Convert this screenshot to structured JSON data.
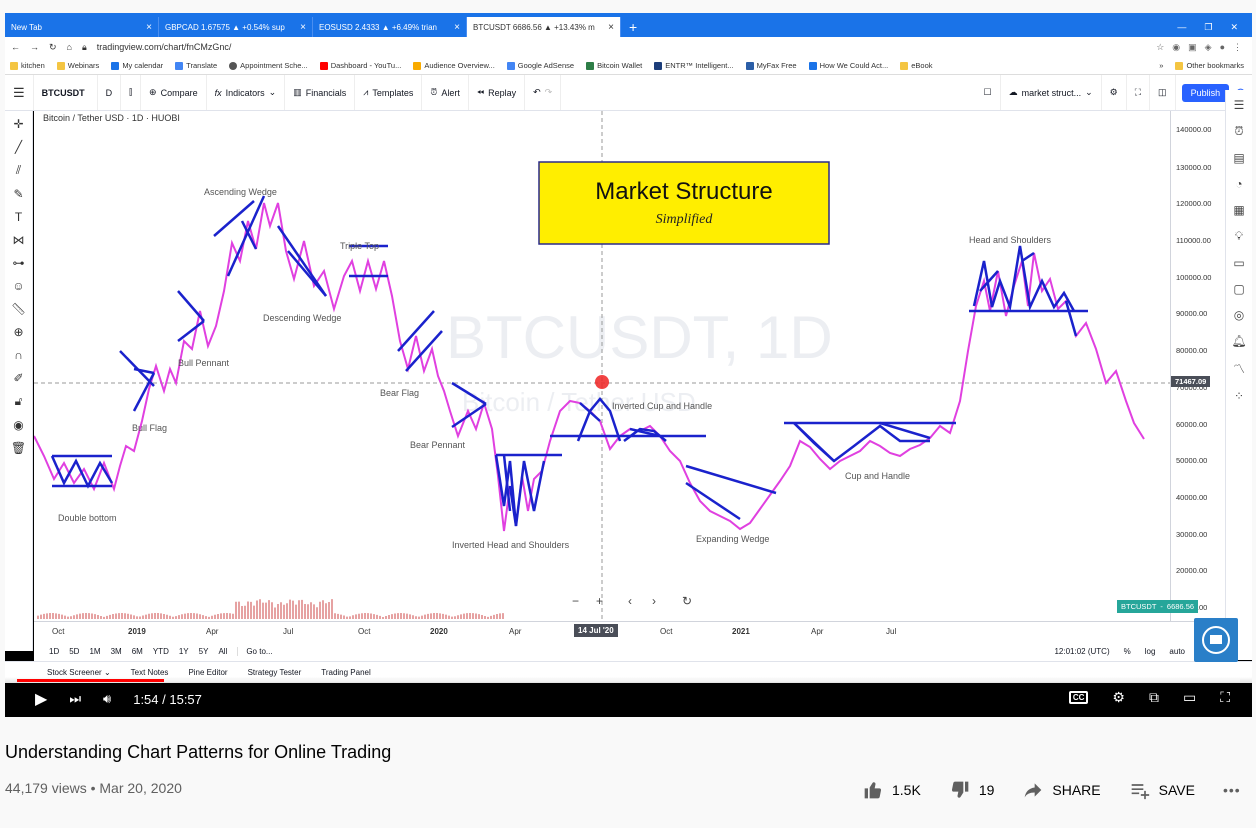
{
  "browser": {
    "tabs": [
      {
        "label": "New Tab",
        "active": false
      },
      {
        "label": "GBPCAD 1.67575 ▲ +0.54% sup",
        "active": false
      },
      {
        "label": "EOSUSD 2.4333 ▲ +6.49% trian",
        "active": false
      },
      {
        "label": "BTCUSDT 6686.56 ▲ +13.43% m",
        "active": true
      }
    ],
    "new_tab": "+",
    "url": "tradingview.com/chart/fnCMzGnc/",
    "bookmarks": [
      "kitchen",
      "Webinars",
      "My calendar",
      "Translate",
      "Appointment Sche...",
      "Dashboard - YouTu...",
      "Audience Overview...",
      "Google AdSense",
      "Bitcoin Wallet",
      "ENTR™ Intelligent...",
      "MyFax Free",
      "How We Could Act...",
      "eBook"
    ],
    "other_bookmarks": "Other bookmarks"
  },
  "tv": {
    "symbol": "BTCUSDT",
    "interval": "D",
    "compare": "Compare",
    "indicators": "Indicators",
    "financials": "Financials",
    "templates": "Templates",
    "alert": "Alert",
    "replay": "Replay",
    "layout_name": "market struct...",
    "publish": "Publish",
    "legend": "Bitcoin / Tether USD · 1D · HUOBI",
    "watermark_title": "BTCUSDT, 1D",
    "watermark_sub": "Bitcoin / Tether USD",
    "banner_title": "Market Structure",
    "banner_sub": "Simplified",
    "crosshair_price": "71467.09",
    "last_price_label": "BTCUSDT",
    "last_price": "6686.56",
    "crosshair_date": "14 Jul '20",
    "time_labels": [
      "Oct",
      "2019",
      "Apr",
      "Jul",
      "Oct",
      "2020",
      "Apr",
      "Jul",
      "Oct",
      "2021",
      "Apr",
      "Jul"
    ],
    "price_labels": [
      "140000.00",
      "130000.00",
      "120000.00",
      "110000.00",
      "100000.00",
      "90000.00",
      "80000.00",
      "70000.00",
      "60000.00",
      "50000.00",
      "40000.00",
      "30000.00",
      "20000.00",
      "10000.00"
    ],
    "ranges": [
      "1D",
      "5D",
      "1M",
      "3M",
      "6M",
      "YTD",
      "1Y",
      "5Y",
      "All"
    ],
    "goto": "Go to...",
    "clock": "12:01:02 (UTC)",
    "pct": "%",
    "log": "log",
    "auto": "auto",
    "bottom_tabs": [
      "Stock Screener",
      "Text Notes",
      "Pine Editor",
      "Strategy Tester",
      "Trading Panel"
    ],
    "patterns": [
      "Double bottom",
      "Bull Flag",
      "Bull Pennant",
      "Ascending Wedge",
      "Descending Wedge",
      "Triple Top",
      "Bear Flag",
      "Bear Pennant",
      "Inverted Head and Shoulders",
      "Inverted Cup and Handle",
      "Expanding Wedge",
      "Cup and Handle",
      "Head and Shoulders"
    ],
    "colors": {
      "price_line": "#e040e0",
      "pattern_line": "#1a22cc",
      "banner_bg": "#ffee00",
      "accent": "#2962ff"
    }
  },
  "video": {
    "time": "1:54 / 15:57",
    "progress": 0.12,
    "title": "Understanding Chart Patterns for Online Trading",
    "meta": "44,179 views • Mar 20, 2020",
    "likes": "1.5K",
    "dislikes": "19",
    "share": "SHARE",
    "save": "SAVE",
    "more": "•••"
  }
}
